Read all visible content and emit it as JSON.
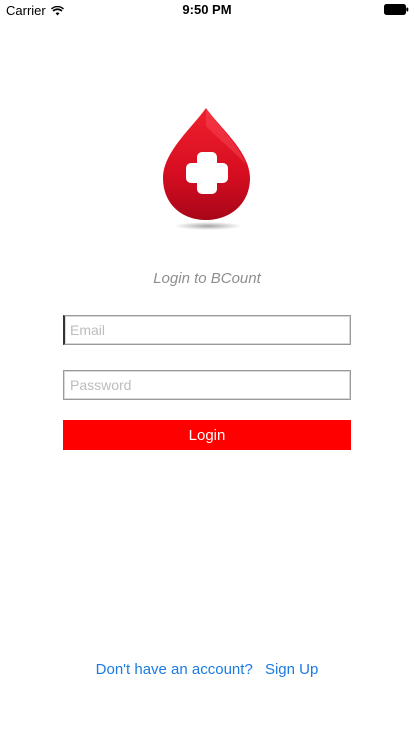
{
  "status_bar": {
    "carrier": "Carrier",
    "time": "9:50 PM",
    "wifi_icon": "wifi-icon",
    "battery_icon": "battery-icon"
  },
  "logo": {
    "icon": "blood-drop-plus-icon",
    "colors": {
      "drop": "#d80f22",
      "cross": "#ffffff"
    }
  },
  "login": {
    "subtitle": "Login to BCount",
    "email_placeholder": "Email",
    "email_value": "",
    "password_placeholder": "Password",
    "password_value": "",
    "button_label": "Login"
  },
  "signup": {
    "prompt": "Don't have an account?",
    "link": "Sign Up"
  },
  "colors": {
    "accent": "#ff0000",
    "link": "#1a7be0",
    "subtitle": "#8e8e8e"
  }
}
